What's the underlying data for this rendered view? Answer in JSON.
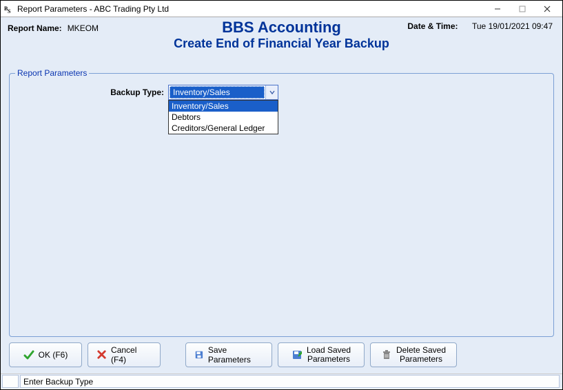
{
  "window": {
    "title": "Report Parameters - ABC Trading Pty Ltd"
  },
  "header": {
    "report_name_label": "Report Name:",
    "report_name_value": "MKEOM",
    "app_title": "BBS Accounting",
    "app_subtitle": "Create End of Financial Year Backup",
    "datetime_label": "Date & Time:",
    "datetime_value": "Tue 19/01/2021 09:47"
  },
  "fieldset": {
    "legend": "Report Parameters",
    "backup_type_label": "Backup Type:",
    "backup_type_value": "Inventory/Sales",
    "options": [
      "Inventory/Sales",
      "Debtors",
      "Creditors/General Ledger"
    ]
  },
  "buttons": {
    "ok": "OK (F6)",
    "cancel": "Cancel (F4)",
    "save_params": "Save Parameters",
    "load_saved_1": "Load Saved",
    "load_saved_2": "Parameters",
    "delete_saved_1": "Delete Saved",
    "delete_saved_2": "Parameters"
  },
  "status": {
    "text": "Enter Backup Type"
  }
}
